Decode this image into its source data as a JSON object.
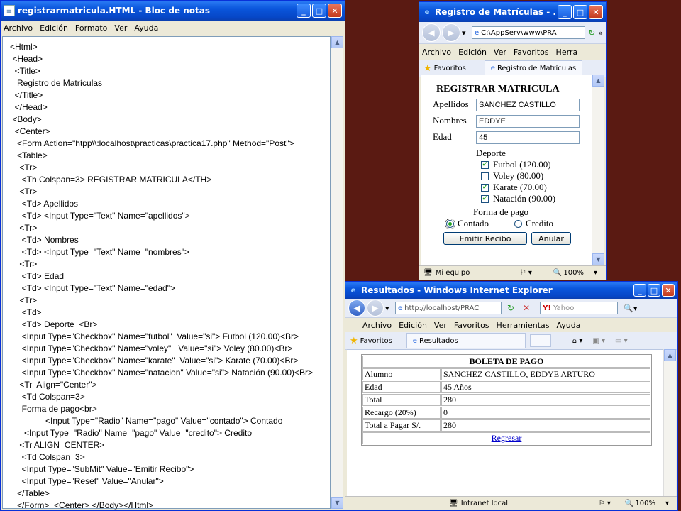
{
  "notepad": {
    "title": "registrarmatricula.HTML - Bloc de notas",
    "menu": [
      "Archivo",
      "Edición",
      "Formato",
      "Ver",
      "Ayuda"
    ],
    "lines": [
      "<Html>",
      " <Head>",
      "  <Title>",
      "   Registro de Matrículas",
      "  </Title>",
      "  </Head>",
      " <Body>",
      "  <Center>",
      "   <Form Action=\"htpp\\\\:localhost\\practicas\\practica17.php\" Method=\"Post\">",
      "   <Table>",
      "    <Tr>",
      "     <Th Colspan=3> REGISTRAR MATRICULA</TH>",
      "    <Tr>",
      "     <Td> Apellidos",
      "     <Td> <Input Type=\"Text\" Name=\"apellidos\">",
      "    <Tr>",
      "     <Td> Nombres",
      "     <Td> <Input Type=\"Text\" Name=\"nombres\">",
      "    <Tr>",
      "     <Td> Edad",
      "     <Td> <Input Type=\"Text\" Name=\"edad\">",
      "    <Tr>",
      "     <Td>",
      "     <Td> Deporte  <Br>",
      "     <Input Type=\"Checkbox\" Name=\"futbol\"  Value=\"si\"> Futbol (120.00)<Br>",
      "     <Input Type=\"Checkbox\" Name=\"voley\"   Value=\"si\"> Voley (80.00)<Br>",
      "     <Input Type=\"Checkbox\" Name=\"karate\"  Value=\"si\"> Karate (70.00)<Br>",
      "     <Input Type=\"Checkbox\" Name=\"natacion\" Value=\"si\"> Natación (90.00)<Br>",
      "    <Tr  Align=\"Center\">",
      "     <Td Colspan=3>",
      "     Forma de pago<br>",
      "               <Input Type=\"Radio\" Name=\"pago\" Value=\"contado\"> Contado",
      "      <Input Type=\"Radio\" Name=\"pago\" Value=\"credito\"> Credito",
      "    <Tr ALIGN=CENTER>",
      "     <Td Colspan=3>",
      "     <Input Type=\"SubMit\" Value=\"Emitir Recibo\">",
      "     <Input Type=\"Reset\" Value=\"Anular\">",
      "   </Table>",
      "   </Form>  <Center> </Body></Html>"
    ]
  },
  "ie_form": {
    "title": "Registro de Matrículas - ...",
    "address": "C:\\AppServ\\www\\PRA",
    "menu": [
      "Archivo",
      "Edición",
      "Ver",
      "Favoritos",
      "Herra"
    ],
    "favorites": "Favoritos",
    "tab": "Registro de Matrículas",
    "status": "Mi equipo",
    "zoom": "100%",
    "form": {
      "header": "REGISTRAR MATRICULA",
      "apellidos_label": "Apellidos",
      "apellidos_value": "SANCHEZ CASTILLO",
      "nombres_label": "Nombres",
      "nombres_value": "EDDYE",
      "edad_label": "Edad",
      "edad_value": "45",
      "deporte_label": "Deporte",
      "sports": [
        {
          "label": "Futbol (120.00)",
          "checked": true
        },
        {
          "label": "Voley (80.00)",
          "checked": false
        },
        {
          "label": "Karate (70.00)",
          "checked": true
        },
        {
          "label": "Natación (90.00)",
          "checked": true
        }
      ],
      "pago_label": "Forma de pago",
      "contado_label": "Contado",
      "credito_label": "Credito",
      "payment_selected": "contado",
      "submit_label": "Emitir Recibo",
      "reset_label": "Anular"
    }
  },
  "ie_result": {
    "title": "Resultados - Windows Internet Explorer",
    "address": "http://localhost/PRAC",
    "search_placeholder": "Yahoo",
    "menu": [
      "Archivo",
      "Edición",
      "Ver",
      "Favoritos",
      "Herramientas",
      "Ayuda"
    ],
    "favorites": "Favoritos",
    "tab": "Resultados",
    "status": "Intranet local",
    "zoom": "100%",
    "receipt": {
      "header": "BOLETA DE PAGO",
      "rows": [
        {
          "label": "Alumno",
          "value": "SANCHEZ CASTILLO, EDDYE ARTURO"
        },
        {
          "label": "Edad",
          "value": "45 Años"
        },
        {
          "label": "Total",
          "value": "280"
        },
        {
          "label": "Recargo (20%)",
          "value": "0"
        },
        {
          "label": "Total a Pagar S/.",
          "value": "280"
        }
      ],
      "link": "Regresar"
    }
  }
}
